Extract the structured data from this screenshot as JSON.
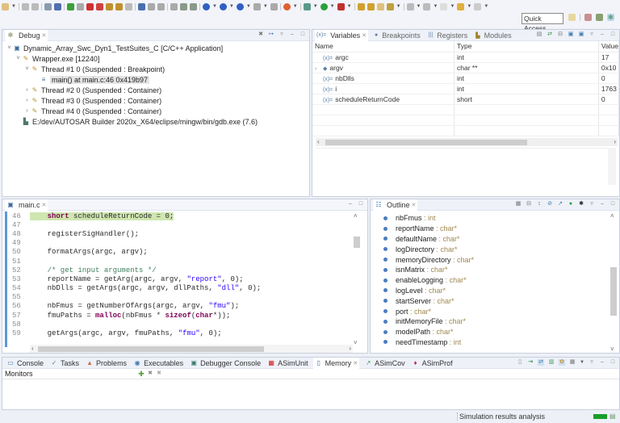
{
  "toolbar": {
    "icons": [
      "new-icon",
      "save-icon",
      "save-all-icon",
      "print-icon",
      "link-icon",
      "resume-icon",
      "suspend-icon",
      "terminate-icon",
      "disconnect-icon",
      "step-into-icon",
      "step-over-icon",
      "step-return-icon",
      "instruction-step-icon",
      "drop-to-frame-icon",
      "use-step-filters-icon",
      "external-tools-icon",
      "build-icon",
      "clean-icon",
      "next-annotation-icon",
      "prev-annotation-icon",
      "nav-icon",
      "window-icon"
    ],
    "quick_access": "Quick Access"
  },
  "debug": {
    "tab": "Debug",
    "tree": [
      {
        "label": "Dynamic_Array_Swc_Dyn1_TestSuites_C [C/C++ Application]",
        "level": 0,
        "expanded": true,
        "icon": "c-app-icon"
      },
      {
        "label": "Wrapper.exe [12240]",
        "level": 1,
        "expanded": true,
        "icon": "process-icon"
      },
      {
        "label": "Thread #1 0 (Suspended : Breakpoint)",
        "level": 2,
        "expanded": true,
        "icon": "thread-icon"
      },
      {
        "label": "main() at main.c:46 0x419b97",
        "level": 3,
        "selected": true,
        "icon": "stack-frame-icon"
      },
      {
        "label": "Thread #2 0 (Suspended : Container)",
        "level": 2,
        "expanded": false,
        "icon": "thread-icon"
      },
      {
        "label": "Thread #3 0 (Suspended : Container)",
        "level": 2,
        "expanded": false,
        "icon": "thread-icon"
      },
      {
        "label": "Thread #4 0 (Suspended : Container)",
        "level": 2,
        "expanded": false,
        "icon": "thread-icon"
      },
      {
        "label": "E:/dev/AUTOSAR Builder 2020x_X64/eclipse/mingw/bin/gdb.exe (7.6)",
        "level": 1,
        "icon": "gdb-icon"
      }
    ]
  },
  "variables": {
    "tabs": [
      "Variables",
      "Breakpoints",
      "Registers",
      "Modules"
    ],
    "columns": [
      "Name",
      "Type",
      "Value"
    ],
    "rows": [
      {
        "name": "argc",
        "type": "int",
        "value": "17",
        "expandable": false
      },
      {
        "name": "argv",
        "type": "char **",
        "value": "0x10",
        "expandable": true
      },
      {
        "name": "nbDlls",
        "type": "int",
        "value": "0",
        "expandable": false
      },
      {
        "name": "i",
        "type": "int",
        "value": "1763",
        "expandable": false
      },
      {
        "name": "scheduleReturnCode",
        "type": "short",
        "value": "0",
        "expandable": false
      }
    ]
  },
  "editor": {
    "tab": "main.c",
    "lines": [
      {
        "n": "46",
        "html": "    <span class='kw'>short</span> scheduleReturnCode = 0;",
        "current": true
      },
      {
        "n": "47",
        "html": ""
      },
      {
        "n": "48",
        "html": "    registerSigHandler();"
      },
      {
        "n": "49",
        "html": ""
      },
      {
        "n": "50",
        "html": "    formatArgs(argc, argv);"
      },
      {
        "n": "51",
        "html": ""
      },
      {
        "n": "52",
        "html": "    <span class='cmt'>/* get input arguments */</span>"
      },
      {
        "n": "53",
        "html": "    reportName = getArg(argc, argv, <span class='str'>\"report\"</span>, 0);"
      },
      {
        "n": "54",
        "html": "    nbDlls = getArgs(argc, argv, dllPaths, <span class='str'>\"dll\"</span>, 0);"
      },
      {
        "n": "55",
        "html": ""
      },
      {
        "n": "56",
        "html": "    nbFmus = getNumberOfArgs(argc, argv, <span class='str'>\"fmu\"</span>);"
      },
      {
        "n": "57",
        "html": "    fmuPaths = <span class='kw'>malloc</span>(nbFmus * <span class='kw'>sizeof</span>(<span class='kw'>char</span>*));"
      },
      {
        "n": "58",
        "html": ""
      },
      {
        "n": "59",
        "html": "    getArgs(argc, argv, fmuPaths, <span class='str'>\"fmu\"</span>, 0);"
      }
    ]
  },
  "outline": {
    "tab": "Outline",
    "items": [
      {
        "name": "nbFmus",
        "type": "int"
      },
      {
        "name": "reportName",
        "type": "char*"
      },
      {
        "name": "defaultName",
        "type": "char*"
      },
      {
        "name": "logDirectory",
        "type": "char*"
      },
      {
        "name": "memoryDirectory",
        "type": "char*"
      },
      {
        "name": "isnMatrix",
        "type": "char*"
      },
      {
        "name": "enableLogging",
        "type": "char*"
      },
      {
        "name": "logLevel",
        "type": "char*"
      },
      {
        "name": "startServer",
        "type": "char*"
      },
      {
        "name": "port",
        "type": "char*"
      },
      {
        "name": "initMemoryFile",
        "type": "char*"
      },
      {
        "name": "modelPath",
        "type": "char*"
      },
      {
        "name": "needTimestamp",
        "type": "int"
      }
    ]
  },
  "bottom": {
    "tabs": [
      {
        "label": "Console",
        "icon": "console-icon"
      },
      {
        "label": "Tasks",
        "icon": "tasks-icon"
      },
      {
        "label": "Problems",
        "icon": "problems-icon"
      },
      {
        "label": "Executables",
        "icon": "executables-icon"
      },
      {
        "label": "Debugger Console",
        "icon": "debugger-console-icon"
      },
      {
        "label": "ASimUnit",
        "icon": "asimunit-icon"
      },
      {
        "label": "Memory",
        "icon": "memory-icon",
        "active": true
      },
      {
        "label": "ASimCov",
        "icon": "asimcov-icon"
      },
      {
        "label": "ASimProf",
        "icon": "asimprof-icon"
      }
    ],
    "monitors_label": "Monitors"
  },
  "status": {
    "text": "Simulation results analysis",
    "progress_color": "#1a9e2a"
  }
}
